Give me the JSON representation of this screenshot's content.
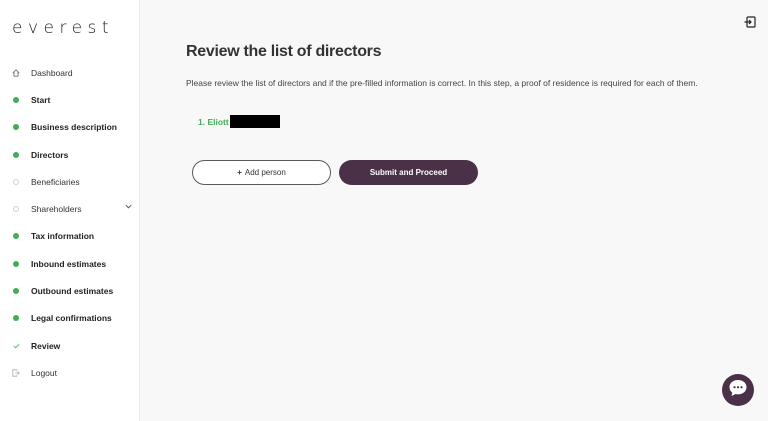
{
  "brand": {
    "logo_text": "everest",
    "accent": "#4a3148",
    "success": "#3fae55"
  },
  "sidebar": {
    "items": [
      {
        "label": "Dashboard",
        "icon": "home-icon",
        "status": "none"
      },
      {
        "label": "Start",
        "icon": "check-dot-icon",
        "status": "done"
      },
      {
        "label": "Business description",
        "icon": "check-dot-icon",
        "status": "done"
      },
      {
        "label": "Directors",
        "icon": "check-dot-icon",
        "status": "done"
      },
      {
        "label": "Beneficiaries",
        "icon": "empty-dot-icon",
        "status": "pending"
      },
      {
        "label": "Shareholders",
        "icon": "empty-dot-icon",
        "status": "pending"
      },
      {
        "label": "Tax information",
        "icon": "check-dot-icon",
        "status": "done"
      },
      {
        "label": "Inbound estimates",
        "icon": "check-dot-icon",
        "status": "done"
      },
      {
        "label": "Outbound estimates",
        "icon": "check-dot-icon",
        "status": "done"
      },
      {
        "label": "Legal confirmations",
        "icon": "check-dot-icon",
        "status": "done"
      },
      {
        "label": "Review",
        "icon": "check-icon",
        "status": "current"
      },
      {
        "label": "Logout",
        "icon": "logout-icon",
        "status": "none"
      }
    ]
  },
  "main": {
    "title": "Review the list of directors",
    "description": "Please review the list of directors and if the pre-filled information is correct. In this step, a proof of residence is required for each of them.",
    "directors": [
      {
        "label": "1. Eliott"
      }
    ],
    "add_button": "Add person",
    "submit_button": "Submit and Proceed"
  },
  "icons": {
    "exit": "exit-icon",
    "chat": "chat-icon",
    "add": "plus-icon"
  }
}
